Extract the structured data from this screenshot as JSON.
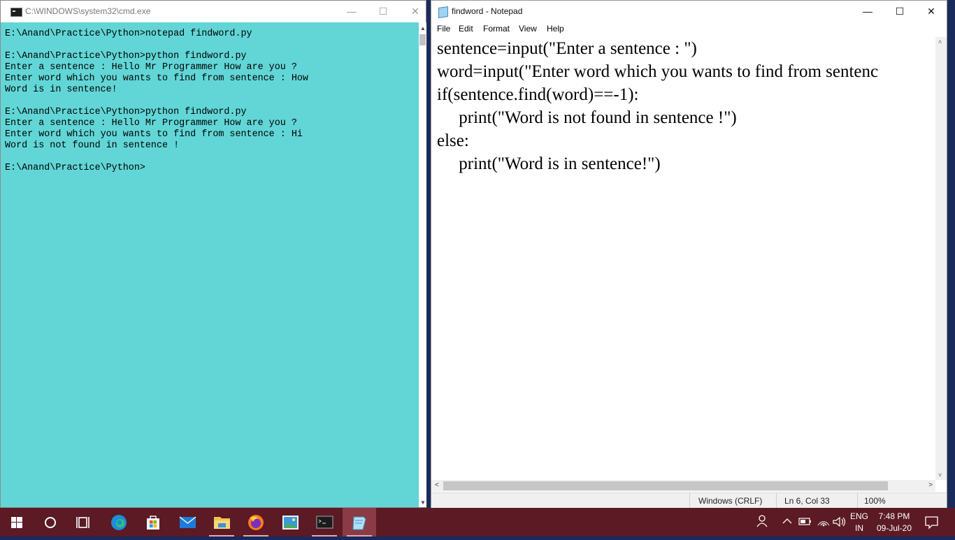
{
  "cmd": {
    "title": "C:\\WINDOWS\\system32\\cmd.exe",
    "lines": [
      "E:\\Anand\\Practice\\Python>notepad findword.py",
      "",
      "E:\\Anand\\Practice\\Python>python findword.py",
      "Enter a sentence : Hello Mr Programmer How are you ?",
      "Enter word which you wants to find from sentence : How",
      "Word is in sentence!",
      "",
      "E:\\Anand\\Practice\\Python>python findword.py",
      "Enter a sentence : Hello Mr Programmer How are you ?",
      "Enter word which you wants to find from sentence : Hi",
      "Word is not found in sentence !",
      "",
      "E:\\Anand\\Practice\\Python>"
    ],
    "minimize_glyph": "—",
    "maximize_glyph": "☐",
    "close_glyph": "✕"
  },
  "notepad": {
    "title": "findword - Notepad",
    "menu": [
      "File",
      "Edit",
      "Format",
      "View",
      "Help"
    ],
    "code_lines": [
      "sentence=input(\"Enter a sentence : \")",
      "word=input(\"Enter word which you wants to find from sentenc",
      "if(sentence.find(word)==-1):",
      "     print(\"Word is not found in sentence !\")",
      "else:",
      "     print(\"Word is in sentence!\")"
    ],
    "status": {
      "encoding": "Windows (CRLF)",
      "position": "Ln 6, Col 33",
      "zoom": "100%"
    },
    "minimize_glyph": "—",
    "maximize_glyph": "☐",
    "close_glyph": "✕"
  },
  "taskbar": {
    "apps": [
      {
        "name": "start-icon"
      },
      {
        "name": "cortana-search-icon"
      },
      {
        "name": "task-view-icon"
      },
      {
        "name": "edge-icon"
      },
      {
        "name": "store-icon"
      },
      {
        "name": "mail-icon"
      },
      {
        "name": "file-explorer-icon"
      },
      {
        "name": "firefox-icon"
      },
      {
        "name": "photos-icon"
      },
      {
        "name": "cmd-icon"
      },
      {
        "name": "notepad-icon"
      }
    ],
    "tray": {
      "lang_top": "ENG",
      "lang_bottom": "IN",
      "time": "7:48 PM",
      "date": "09-Jul-20"
    },
    "accent": "#5b1a24"
  },
  "colors": {
    "cmd_background": "#62d6d6",
    "taskbar": "#5b1a24"
  }
}
